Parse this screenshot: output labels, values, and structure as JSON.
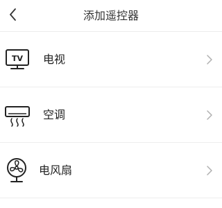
{
  "header": {
    "title": "添加遥控器",
    "back_icon": "chevron-left-icon"
  },
  "devices": [
    {
      "label": "电视",
      "icon": "tv-icon"
    },
    {
      "label": "空调",
      "icon": "air-conditioner-icon"
    },
    {
      "label": "电风扇",
      "icon": "fan-icon"
    }
  ],
  "colors": {
    "text": "#222222",
    "divider": "#ededed",
    "chevron": "#b0b0b0"
  }
}
